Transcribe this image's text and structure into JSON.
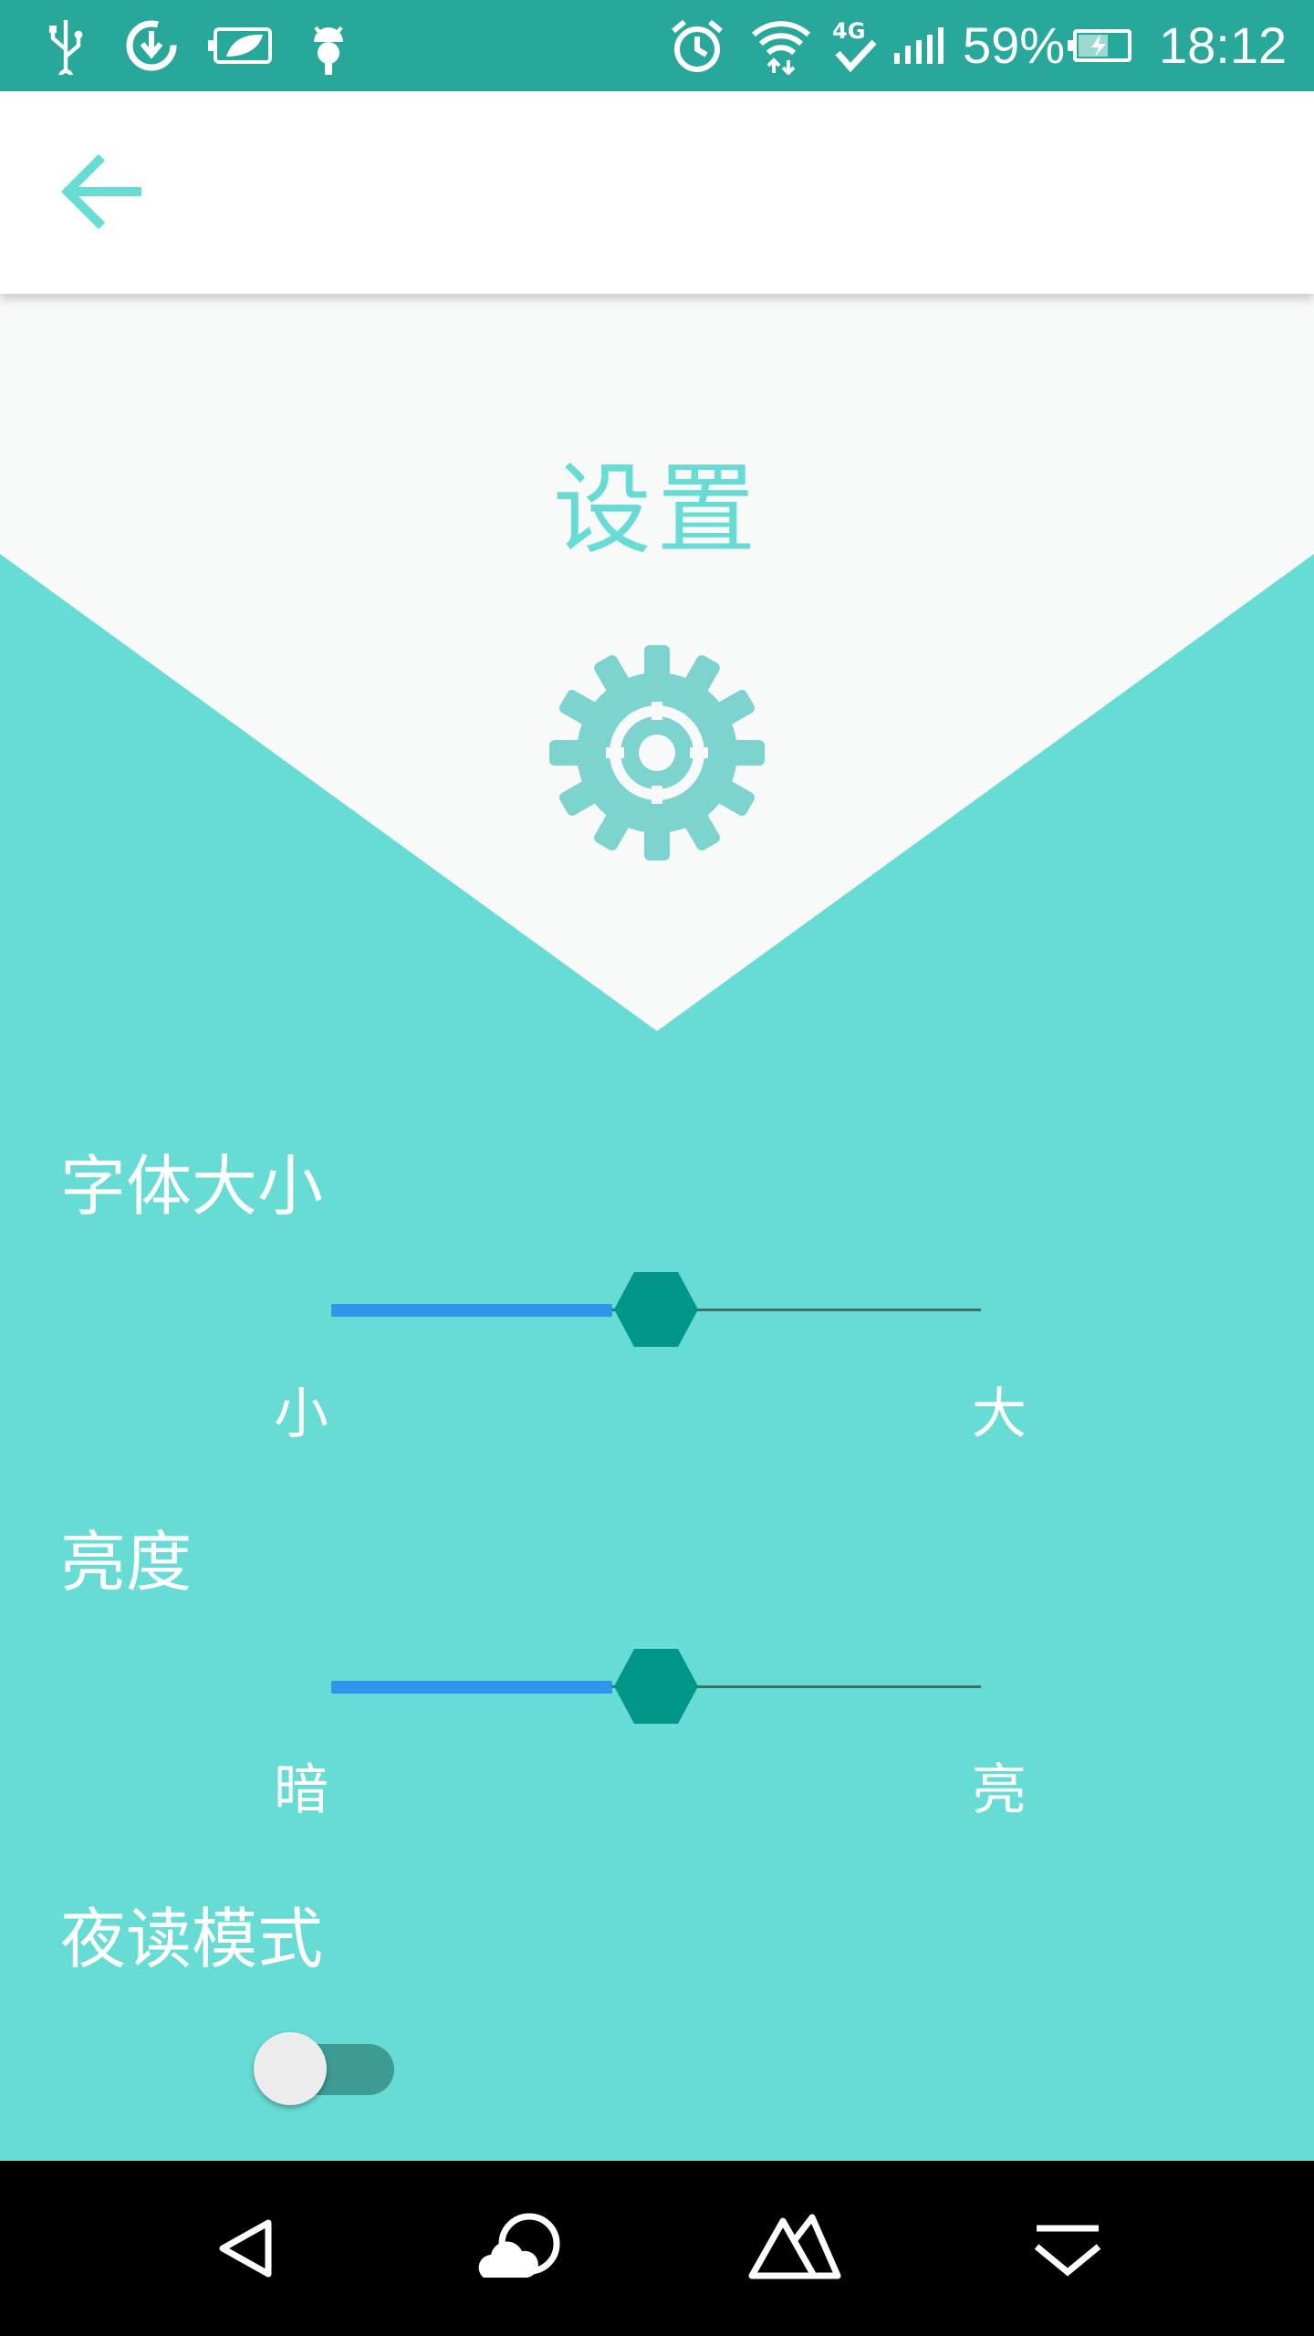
{
  "status_bar": {
    "battery_percent": "59%",
    "time": "18:12",
    "network": "4G",
    "icons": [
      "usb-icon",
      "sync-icon",
      "battery-saver-icon",
      "android-icon",
      "alarm-icon",
      "wifi-icon",
      "network-4g-icon",
      "signal-icon",
      "battery-charging-icon"
    ]
  },
  "toolbar": {
    "back_icon": "arrow-left-icon"
  },
  "header": {
    "title": "设置",
    "icon": "gear-icon"
  },
  "settings": {
    "font_size": {
      "label": "字体大小",
      "min_label": "小",
      "max_label": "大",
      "value": 0.5
    },
    "brightness": {
      "label": "亮度",
      "min_label": "暗",
      "max_label": "亮",
      "value": 0.5
    },
    "night_mode": {
      "label": "夜读模式",
      "enabled": false
    }
  },
  "nav_bar": {
    "buttons": [
      "back-triangle-icon",
      "cloud-icon",
      "mountain-icon",
      "dropdown-icon"
    ]
  },
  "colors": {
    "accent": "#66dcd4",
    "status_bar": "#27a89a",
    "slider_fill": "#2d95ea",
    "thumb": "#009688"
  }
}
